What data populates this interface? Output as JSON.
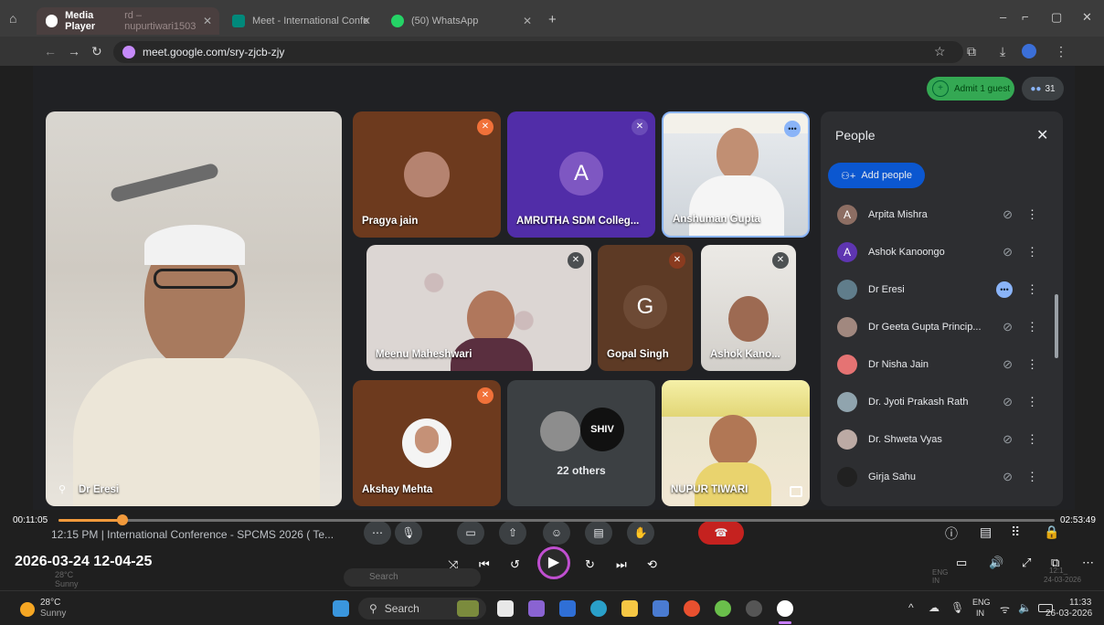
{
  "tabs": [
    {
      "label": "Media Player",
      "overlay": "rd – nupurtiwari1503",
      "active": true
    },
    {
      "label": "Meet - International Confe",
      "active": false
    },
    {
      "label": "(50) WhatsApp",
      "active": false
    }
  ],
  "address": {
    "url": "meet.google.com/sry-zjcb-zjy"
  },
  "meet": {
    "admit_label": "Admit 1 guest",
    "participants_count": "31",
    "tiles": {
      "main": "Dr Eresi",
      "pragya": "Pragya jain",
      "amrutha": "AMRUTHA SDM Colleg...",
      "amrutha_initial": "A",
      "anshuman": "Anshuman Gupta",
      "meenu": "Meenu Maheshwari",
      "gopal": "Gopal Singh",
      "gopal_initial": "G",
      "ashok": "Ashok Kano...",
      "akshay": "Akshay Mehta",
      "others": "22 others",
      "nupur": "NUPUR TIWARI"
    },
    "people_panel": {
      "title": "People",
      "add_label": "Add people",
      "list": [
        {
          "name": "Arpita Mishra",
          "initial": "A",
          "color": "#8d6e63"
        },
        {
          "name": "Ashok Kanoongo",
          "initial": "A",
          "color": "#5e35b1"
        },
        {
          "name": "Dr Eresi",
          "initial": "",
          "color": "#607d8b"
        },
        {
          "name": "Dr Geeta Gupta Princip...",
          "initial": "",
          "color": "#a1887f"
        },
        {
          "name": "Dr Nisha Jain",
          "initial": "",
          "color": "#e57373"
        },
        {
          "name": "Dr. Jyoti Prakash Rath",
          "initial": "",
          "color": "#90a4ae"
        },
        {
          "name": "Dr. Shweta Vyas",
          "initial": "",
          "color": "#bcaaa4"
        },
        {
          "name": "Girja Sahu",
          "initial": "",
          "color": "#212121"
        }
      ]
    },
    "bottom_info": "12:15 PM  |  International Conference - SPCMS 2026 ( Te..."
  },
  "player": {
    "elapsed": "00:11:05",
    "total": "02:53:49",
    "progress": 0.064,
    "timestamp": "2026-03-24 12-04-25",
    "ghost_weather": "28°C Sunny",
    "ghost_search": "Search",
    "ghost_lang": "ENG IN",
    "ghost_time": "12:1_",
    "ghost_date": "24-03-2026"
  },
  "taskbar": {
    "temp": "28°C",
    "weather": "Sunny",
    "search": "Search",
    "lang_top": "ENG",
    "lang_bottom": "IN",
    "time": "11:33",
    "date": "26-03-2026"
  },
  "colors": {
    "accent": "#8ab4f8",
    "admit": "#34a853",
    "meet_bg": "#202124"
  }
}
